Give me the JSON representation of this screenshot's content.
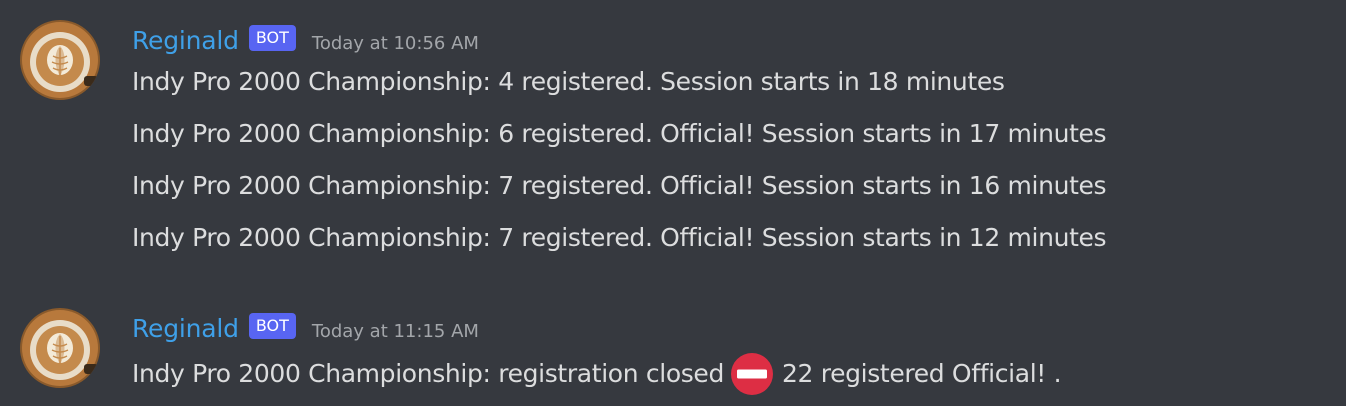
{
  "groups": [
    {
      "author": "Reginald",
      "tag": "BOT",
      "timestamp": "Today at 10:56 AM",
      "messages": [
        "Indy Pro 2000 Championship: 4 registered. Session starts in 18 minutes",
        "Indy Pro 2000 Championship: 6 registered. Official! Session starts in 17 minutes",
        "Indy Pro 2000 Championship: 7 registered. Official! Session starts in 16 minutes",
        "Indy Pro 2000 Championship: 7 registered. Official! Session starts in 12 minutes"
      ]
    },
    {
      "author": "Reginald",
      "tag": "BOT",
      "timestamp": "Today at 11:15 AM",
      "messages": [
        {
          "before": "Indy Pro 2000 Championship: registration closed",
          "emoji": "no-entry-icon",
          "after": "22 registered Official! ."
        }
      ]
    }
  ],
  "colors": {
    "background": "#36393f",
    "username": "#3fa0e8",
    "bot_tag": "#5865f2",
    "message_text": "#dcddde",
    "timestamp": "#a3a6aa",
    "no_entry_red": "#dd2e44"
  }
}
